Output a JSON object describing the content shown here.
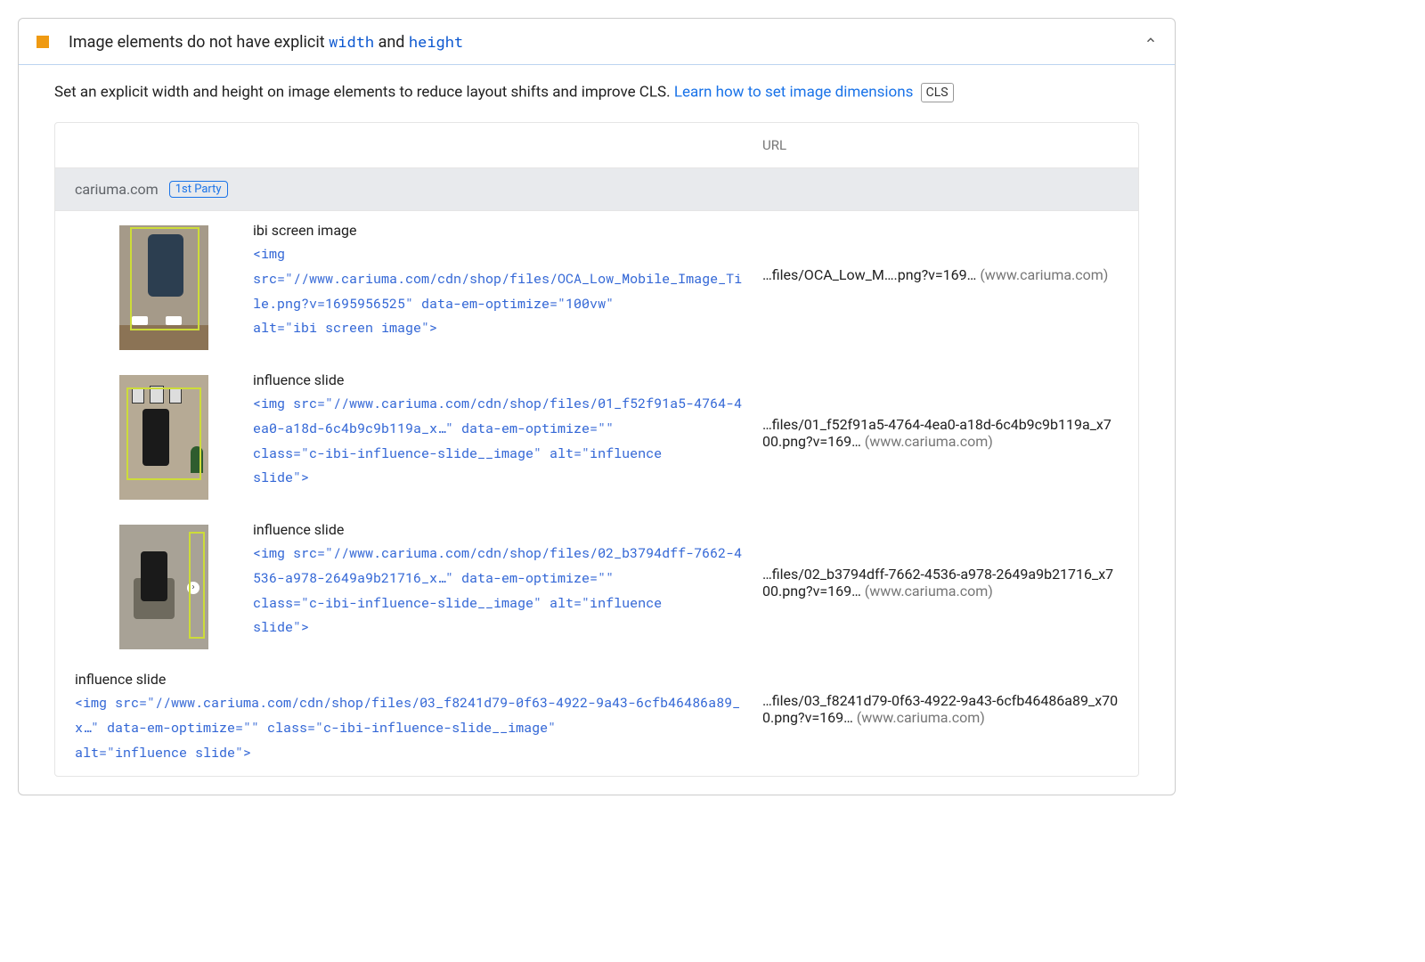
{
  "audit": {
    "status_color": "#EF9A12",
    "title_pre": "Image elements do not have explicit ",
    "code1": "width",
    "title_mid": " and ",
    "code2": "height",
    "chevron": "chevron-up-icon",
    "description_pre": "Set an explicit width and height on image elements to reduce layout shifts and improve CLS. ",
    "learn_link": "Learn how to set image dimensions",
    "cls_badge": "CLS",
    "table": {
      "header_url": "URL",
      "host": "cariuma.com",
      "party_badge": "1st Party",
      "rows": [
        {
          "has_thumb": true,
          "thumb_variant": 1,
          "label": "ibi screen image",
          "snippet": "<img\nsrc=\"//www.cariuma.com/cdn/shop/files/OCA_Low_Mobile_Image_Tile.png?v=1695956525\" data-em-optimize=\"100vw\"\nalt=\"ibi screen image\">",
          "url_text": "…files/OCA_Low_M….png?v=169…",
          "origin": "(www.cariuma.com)"
        },
        {
          "has_thumb": true,
          "thumb_variant": 2,
          "label": "influence slide",
          "snippet": "<img src=\"//www.cariuma.com/cdn/shop/files/01_f52f91a5-4764-4ea0-a18d-6c4b9c9b119a_x…\" data-em-optimize=\"\"\nclass=\"c-ibi-influence-slide__image\" alt=\"influence\nslide\">",
          "url_text": "…files/01_f52f91a5-4764-4ea0-a18d-6c4b9c9b119a_x700.png?v=169…",
          "origin": "(www.cariuma.com)"
        },
        {
          "has_thumb": true,
          "thumb_variant": 3,
          "label": "influence slide",
          "snippet": "<img src=\"//www.cariuma.com/cdn/shop/files/02_b3794dff-7662-4536-a978-2649a9b21716_x…\" data-em-optimize=\"\"\nclass=\"c-ibi-influence-slide__image\" alt=\"influence\nslide\">",
          "url_text": "…files/02_b3794dff-7662-4536-a978-2649a9b21716_x700.png?v=169…",
          "origin": "(www.cariuma.com)"
        },
        {
          "has_thumb": false,
          "label": "influence slide",
          "snippet": "<img src=\"//www.cariuma.com/cdn/shop/files/03_f8241d79-0f63-4922-9a43-6cfb46486a89_x…\" data-em-optimize=\"\" class=\"c-ibi-influence-slide__image\"\nalt=\"influence slide\">",
          "url_text": "…files/03_f8241d79-0f63-4922-9a43-6cfb46486a89_x700.png?v=169…",
          "origin": "(www.cariuma.com)"
        }
      ]
    }
  }
}
